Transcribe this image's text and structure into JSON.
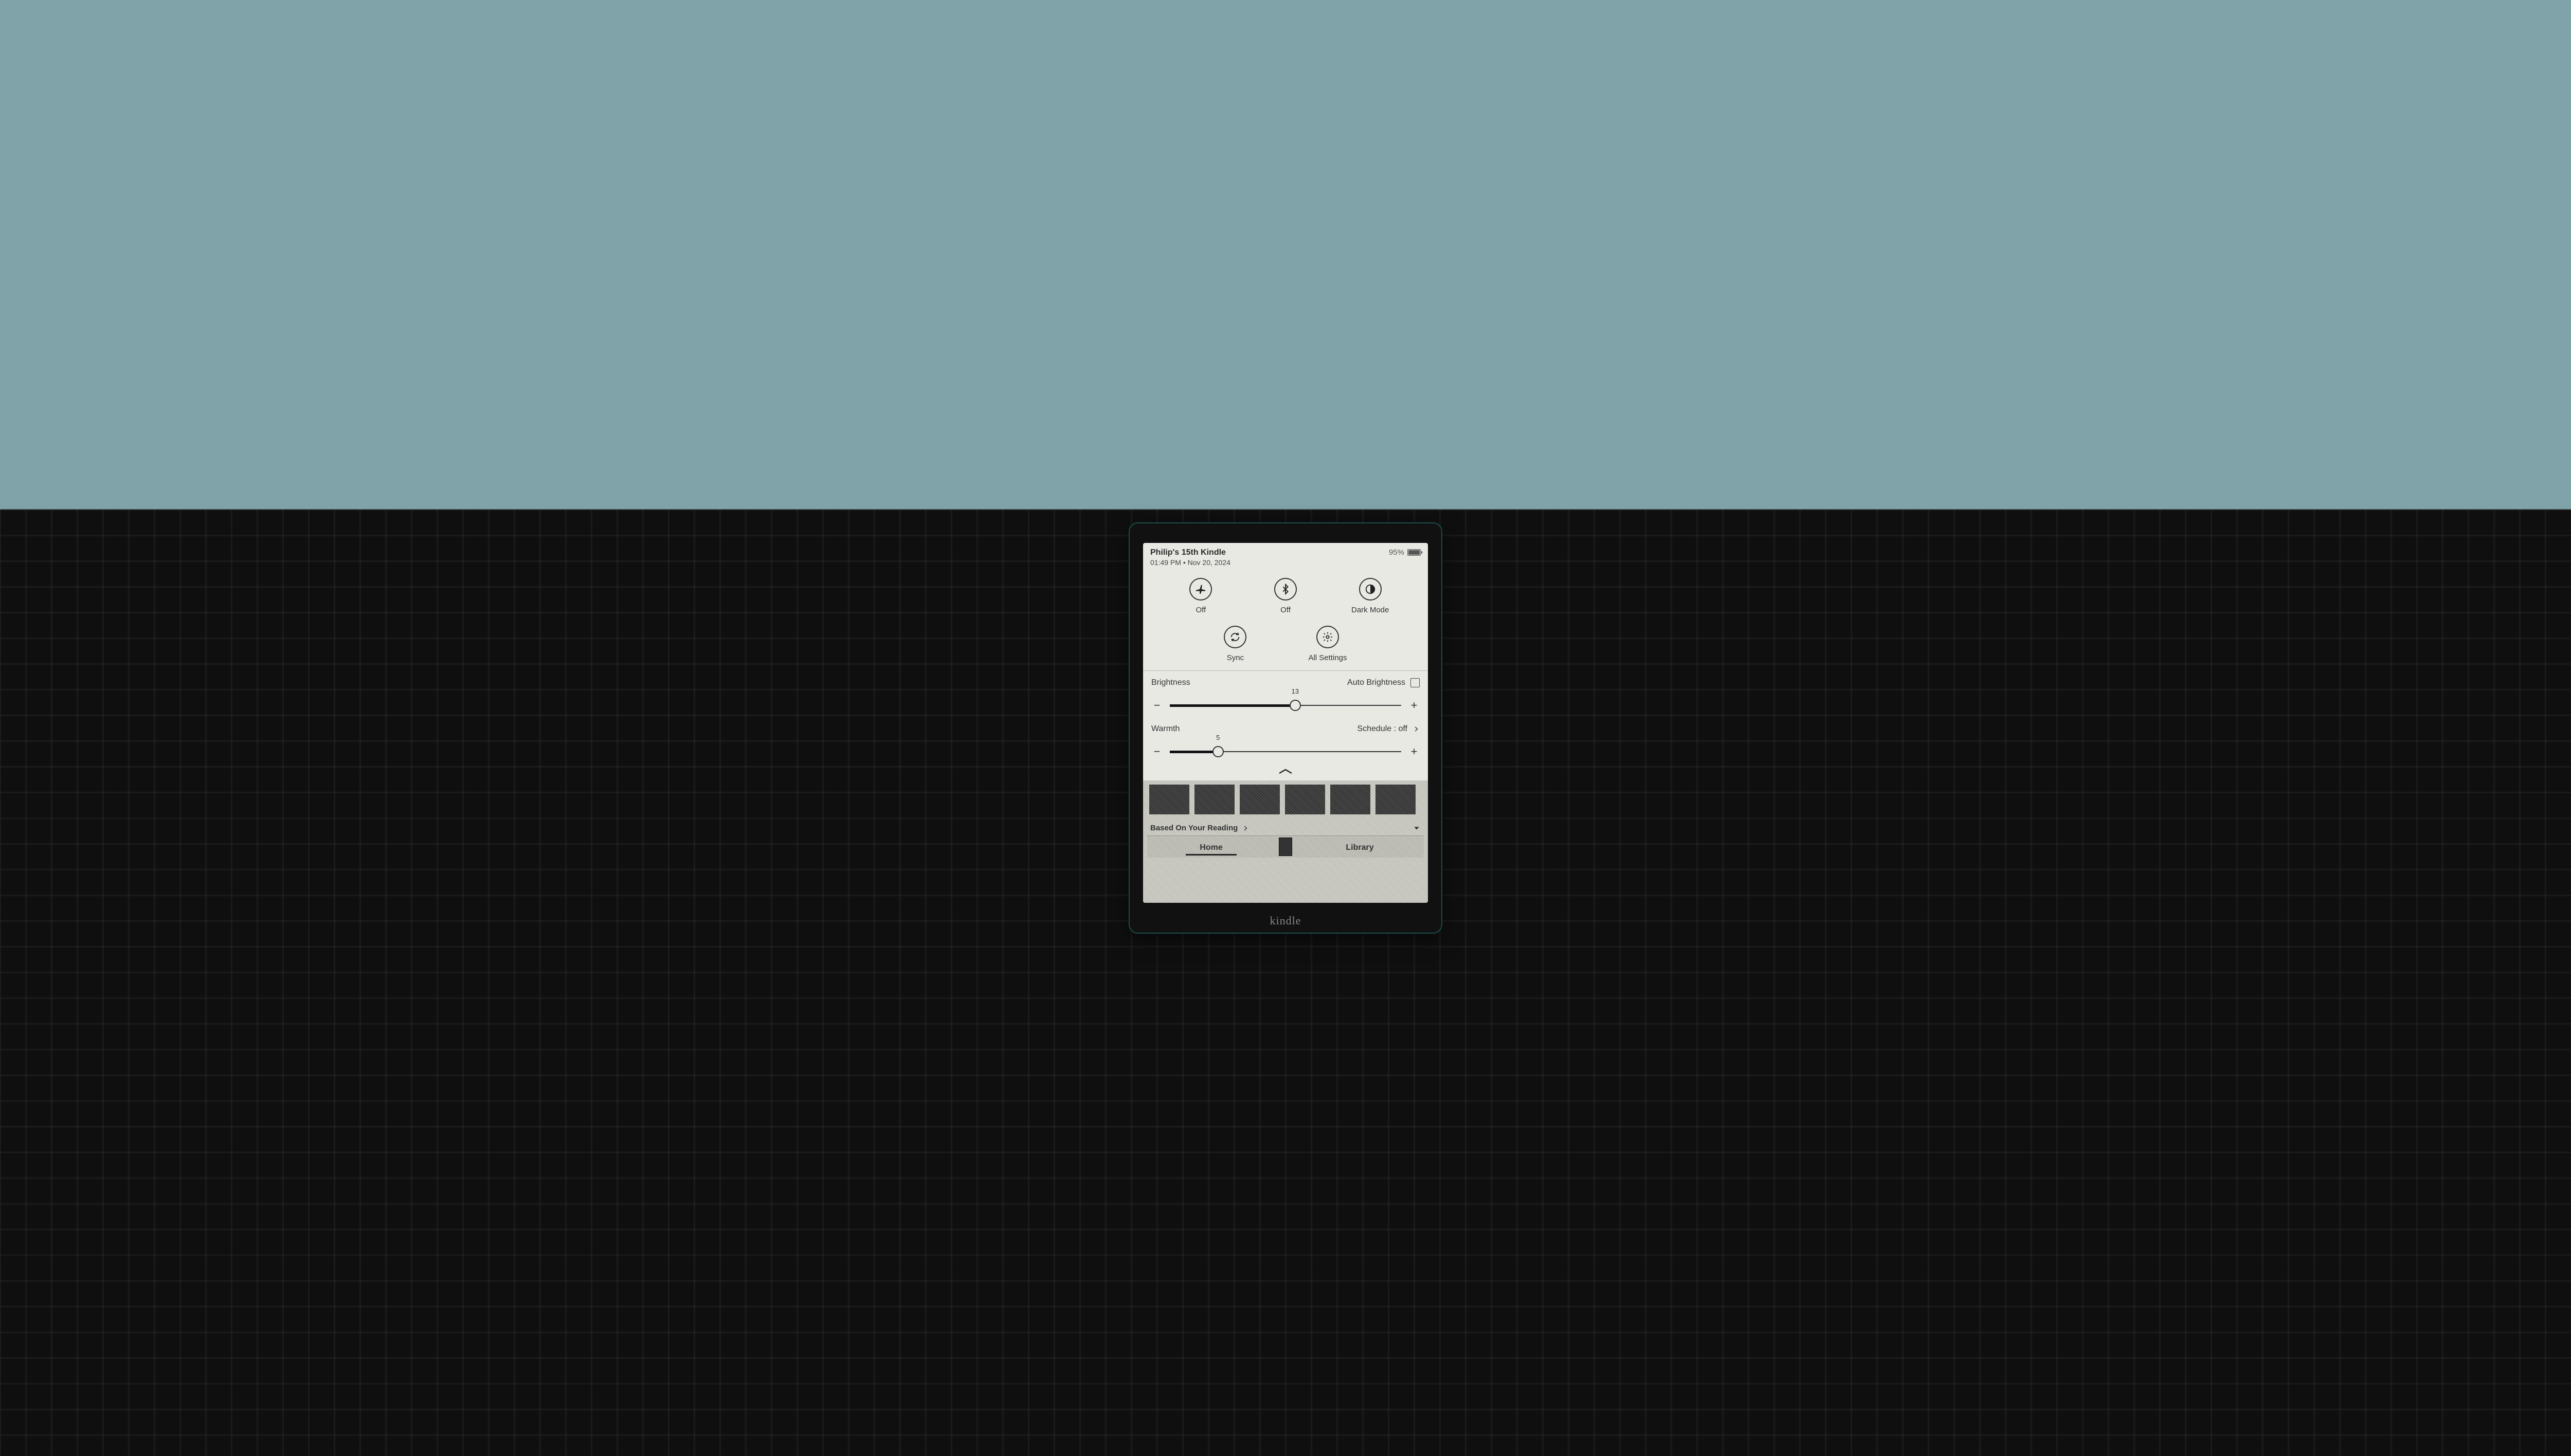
{
  "status": {
    "device_name": "Philip's 15th Kindle",
    "time": "01:49 PM",
    "date": "Nov 20, 2024",
    "battery_percent": "95%"
  },
  "toggles": {
    "airplane": {
      "label": "Off"
    },
    "bluetooth": {
      "label": "Off"
    },
    "darkmode": {
      "label": "Dark Mode"
    },
    "sync": {
      "label": "Sync"
    },
    "settings": {
      "label": "All Settings"
    }
  },
  "brightness": {
    "title": "Brightness",
    "auto_label": "Auto Brightness",
    "auto_checked": false,
    "value": 13,
    "max": 24
  },
  "warmth": {
    "title": "Warmth",
    "schedule_label": "Schedule : off",
    "value": 5,
    "max": 24
  },
  "shelf": {
    "section_title": "Based On Your Reading"
  },
  "nav": {
    "home": "Home",
    "library": "Library"
  },
  "brand": "kindle"
}
